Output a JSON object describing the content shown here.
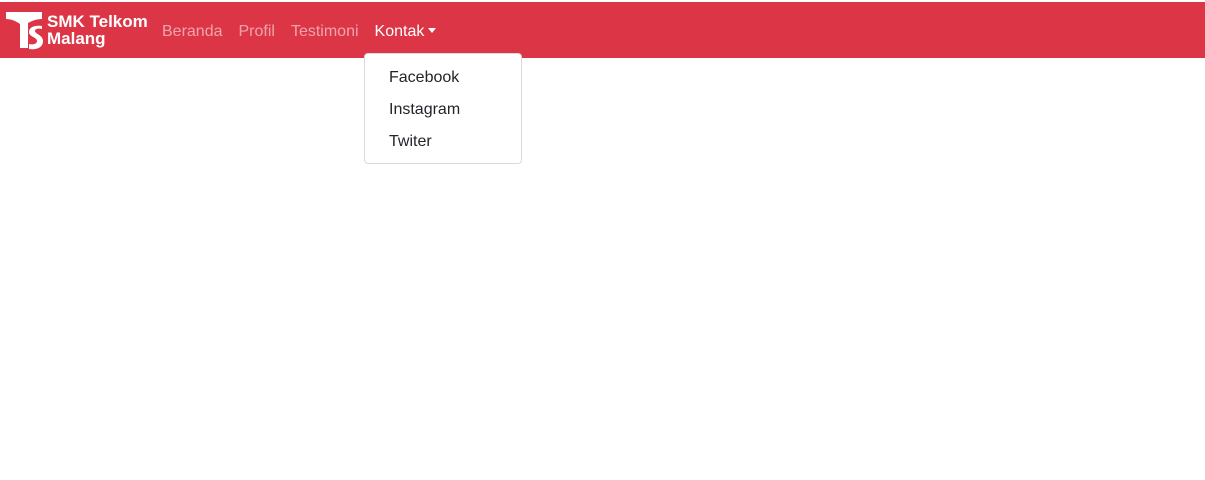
{
  "brand": {
    "line1": "SMK Telkom",
    "line2": "Malang",
    "logo_icon": "telkom-ts-logo-icon"
  },
  "nav": {
    "items": [
      {
        "label": "Beranda",
        "active": false
      },
      {
        "label": "Profil",
        "active": false
      },
      {
        "label": "Testimoni",
        "active": false
      },
      {
        "label": "Kontak",
        "active": true,
        "dropdown": true
      }
    ]
  },
  "dropdown": {
    "open": true,
    "items": [
      {
        "label": "Facebook"
      },
      {
        "label": "Instagram"
      },
      {
        "label": "Twiter"
      }
    ]
  },
  "colors": {
    "navbar_bg": "#dc3545",
    "nav_link": "rgba(255,255,255,0.55)",
    "nav_link_active": "#ffffff",
    "dropdown_text": "#212529"
  }
}
